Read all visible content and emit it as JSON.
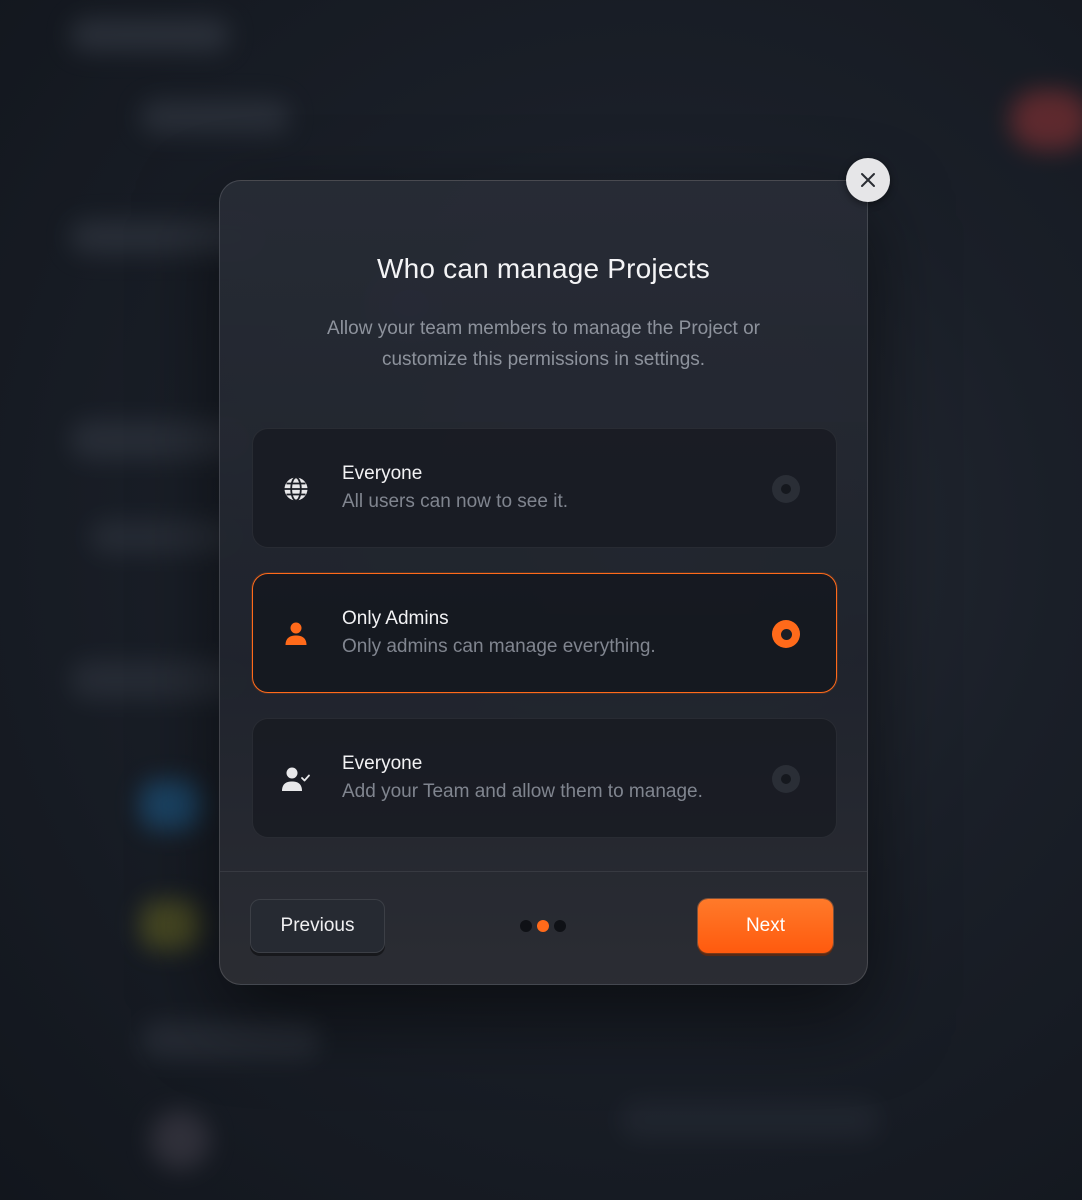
{
  "dialog": {
    "title": "Who can manage Projects",
    "subtitle": "Allow your team members to manage the Project or customize this permissions in settings."
  },
  "options": [
    {
      "title": "Everyone",
      "description": "All users can now to see it.",
      "icon": "globe-icon",
      "selected": false
    },
    {
      "title": "Only Admins",
      "description": "Only admins can manage everything.",
      "icon": "user-icon",
      "selected": true
    },
    {
      "title": "Everyone",
      "description": "Add your Team and allow them to manage.",
      "icon": "user-check-icon",
      "selected": false
    }
  ],
  "footer": {
    "previous_label": "Previous",
    "next_label": "Next",
    "pager": {
      "current": 2,
      "total": 3
    }
  },
  "colors": {
    "accent": "#ff6a1a",
    "background": "#151a22",
    "modal": "#23272f"
  }
}
